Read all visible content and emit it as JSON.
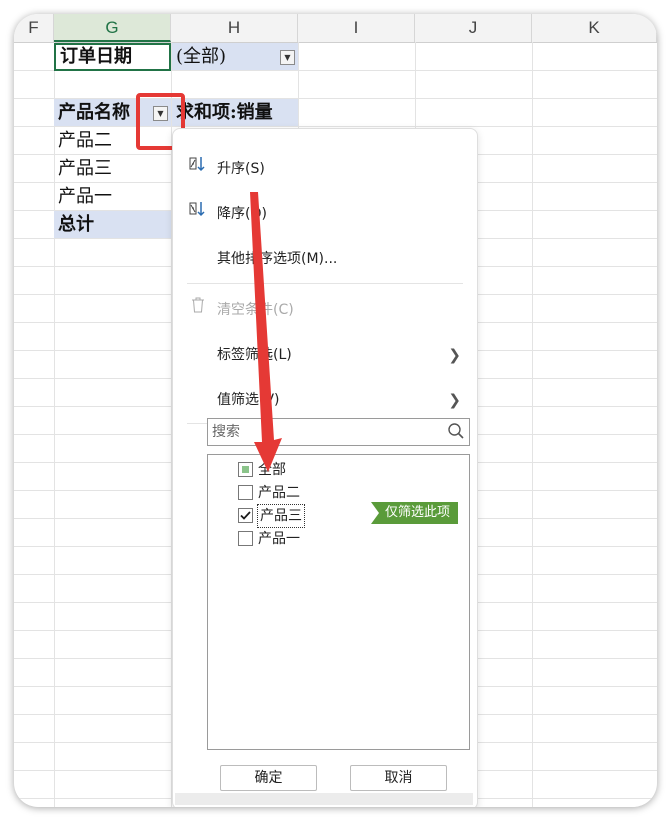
{
  "columns": [
    "F",
    "G",
    "H",
    "I",
    "J",
    "K"
  ],
  "sheet": {
    "order_date_label": "订单日期",
    "order_date_value": "(全部)",
    "row_header": "产品名称",
    "sum_header": "求和项:销量",
    "rows": [
      "产品二",
      "产品三",
      "产品一"
    ],
    "total": "总计"
  },
  "menu": {
    "sort_asc": "升序(S)",
    "sort_desc": "降序(O)",
    "more_sort": "其他排序选项(M)...",
    "clear": "清空条件(C)",
    "label_filter": "标签筛选(L)",
    "value_filter": "值筛选(V)",
    "search_placeholder": "搜索",
    "items": [
      {
        "label": "全部",
        "state": "partial"
      },
      {
        "label": "产品二",
        "state": "unchecked"
      },
      {
        "label": "产品三",
        "state": "checked"
      },
      {
        "label": "产品一",
        "state": "unchecked"
      }
    ],
    "only_this": "仅筛选此项",
    "ok": "确定",
    "cancel": "取消"
  },
  "colors": {
    "accent_green": "#217346",
    "header_blue": "#d9e1f2",
    "tag_green": "#5a9b3a",
    "annotation_red": "#e53935"
  }
}
